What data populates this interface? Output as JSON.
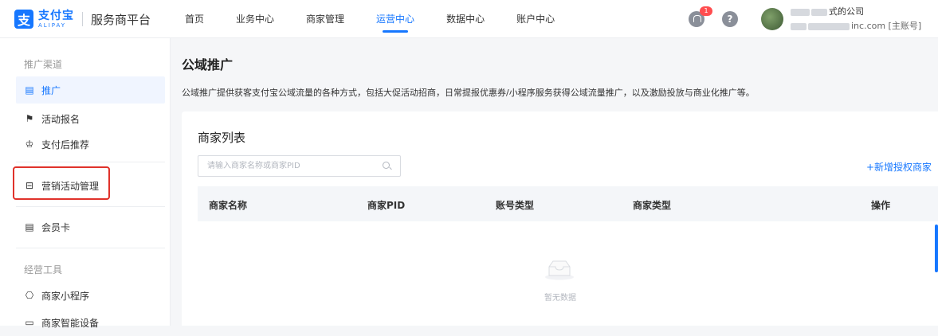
{
  "header": {
    "logo_mark": "支",
    "logo_cn": "支付宝",
    "logo_en": "ALIPAY",
    "platform": "服务商平台",
    "nav": [
      {
        "label": "首页",
        "active": false
      },
      {
        "label": "业务中心",
        "active": false
      },
      {
        "label": "商家管理",
        "active": false
      },
      {
        "label": "运营中心",
        "active": true
      },
      {
        "label": "数据中心",
        "active": false
      },
      {
        "label": "账户中心",
        "active": false
      }
    ],
    "notification_count": "1",
    "help_label": "?",
    "account_name_suffix": "式的公司",
    "account_mail_suffix": "inc.com [主账号]"
  },
  "sidebar": {
    "group1": "推广渠道",
    "items1": [
      {
        "label": "推广",
        "icon": "list-doc-icon",
        "glyph": "▤",
        "active": true
      },
      {
        "label": "活动报名",
        "icon": "flag-icon",
        "glyph": "⚑",
        "active": false
      },
      {
        "label": "支付后推荐",
        "icon": "crown-icon",
        "glyph": "♔",
        "active": false
      },
      {
        "label": "营销活动管理",
        "icon": "gift-box-icon",
        "glyph": "⊟",
        "active": false
      },
      {
        "label": "会员卡",
        "icon": "card-doc-icon",
        "glyph": "▤",
        "active": false
      }
    ],
    "group2": "经营工具",
    "items2": [
      {
        "label": "商家小程序",
        "icon": "mini-program-icon",
        "glyph": "⎔",
        "active": false
      },
      {
        "label": "商家智能设备",
        "icon": "device-icon",
        "glyph": "▭",
        "active": false
      }
    ]
  },
  "main": {
    "title": "公域推广",
    "description": "公域推广提供获客支付宝公域流量的各种方式，包括大促活动招商，日常提报优惠券/小程序服务获得公域流量推广，以及激励投放与商业化推广等。",
    "list_title": "商家列表",
    "search_placeholder": "请输入商家名称或商家PID",
    "add_label": "+新增授权商家",
    "columns": [
      "商家名称",
      "商家PID",
      "账号类型",
      "商家类型",
      "操作"
    ],
    "empty_text": "暂无数据"
  },
  "colors": {
    "accent": "#1677ff",
    "highlight": "#e0322b",
    "badge": "#ff4d4f"
  }
}
